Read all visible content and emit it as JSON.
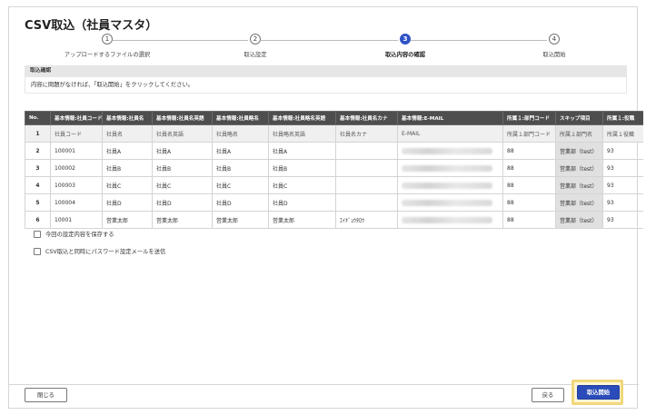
{
  "page": {
    "title": "CSV取込（社員マスタ）"
  },
  "stepper": {
    "steps": [
      {
        "num": "1",
        "label": "アップロードするファイルの選択"
      },
      {
        "num": "2",
        "label": "取込設定"
      },
      {
        "num": "3",
        "label": "取込内容の確認"
      },
      {
        "num": "4",
        "label": "取込開始"
      }
    ],
    "active_step": 3
  },
  "section": {
    "title": "取込確認",
    "message": "内容に問題がなければ、「取込開始」をクリックしてください。"
  },
  "table": {
    "headers": [
      "No.",
      "基本情報:社員コード",
      "基本情報:社員名",
      "基本情報:社員名英語",
      "基本情報:社員略名",
      "基本情報:社員略名英語",
      "基本情報:社員名カナ",
      "基本情報:E-MAIL",
      "所属１:部門コード",
      "スキップ項目",
      "所属１:役職"
    ],
    "label_row": [
      "1",
      "社員コード",
      "社員名",
      "社員名英語",
      "社員略名",
      "社員略名英語",
      "社員名カナ",
      "E-MAIL",
      "所属１部門コード",
      "所属１部門名",
      "所属１役職"
    ],
    "rows": [
      [
        "2",
        "100001",
        "社員A",
        "社員A",
        "社員A",
        "社員A",
        "",
        "",
        "88",
        "営業部（test）",
        "93"
      ],
      [
        "3",
        "100002",
        "社員B",
        "社員B",
        "社員B",
        "社員B",
        "",
        "",
        "88",
        "営業部（test）",
        "93"
      ],
      [
        "4",
        "100003",
        "社員C",
        "社員C",
        "社員C",
        "社員C",
        "",
        "",
        "88",
        "営業部（test）",
        "93"
      ],
      [
        "5",
        "100004",
        "社員D",
        "社員D",
        "社員D",
        "社員D",
        "",
        "",
        "88",
        "営業部（test）",
        "93"
      ],
      [
        "6",
        "10001",
        "営業太郎",
        "営業太郎",
        "営業太郎",
        "営業太郎",
        "ｴｲｷﾞｮｳﾀﾛｳ",
        "",
        "88",
        "営業部（test）",
        "93"
      ]
    ]
  },
  "options": {
    "save_settings": "今回の設定内容を保存する",
    "send_password_mail": "CSV取込と同時にパスワード設定メールを送信"
  },
  "footer": {
    "close_label": "閉じる",
    "back_label": "戻る",
    "start_label": "取込開始"
  },
  "colors": {
    "accent": "#2f52c5",
    "table_header": "#4e4e4e",
    "highlight": "#f1d77b"
  }
}
